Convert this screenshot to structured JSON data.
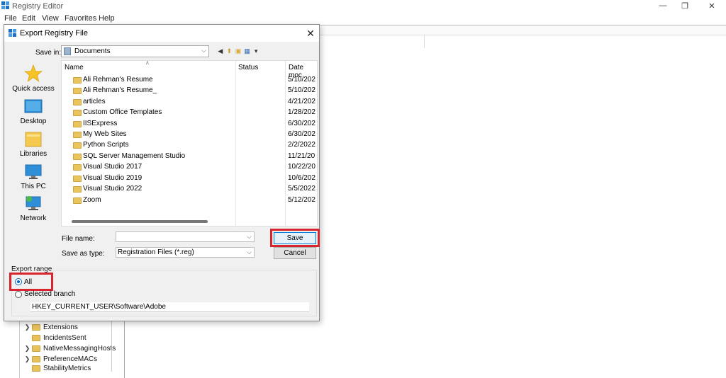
{
  "app": {
    "title": "Registry Editor",
    "menu": [
      "File",
      "Edit",
      "View",
      "Favorites",
      "Help"
    ],
    "window_controls": {
      "minimize": "—",
      "maximize": "❐",
      "close": "✕"
    }
  },
  "tree": {
    "items": [
      {
        "label": "Extensions",
        "expandable": true
      },
      {
        "label": "IncidentsSent",
        "expandable": false
      },
      {
        "label": "NativeMessagingHosts",
        "expandable": true
      },
      {
        "label": "PreferenceMACs",
        "expandable": true
      },
      {
        "label": "StabilityMetrics",
        "expandable": false
      }
    ]
  },
  "dialog": {
    "title": "Export Registry File",
    "close": "✕",
    "save_in_label": "Save in:",
    "save_in_value": "Documents",
    "places": [
      "Quick access",
      "Desktop",
      "Libraries",
      "This PC",
      "Network"
    ],
    "columns": {
      "name": "Name",
      "status": "Status",
      "date": "Date moc"
    },
    "files": [
      {
        "name": "Ali Rehman's Resume",
        "date": "5/10/202"
      },
      {
        "name": "Ali Rehman's Resume_",
        "date": "5/10/202"
      },
      {
        "name": "articles",
        "date": "4/21/202"
      },
      {
        "name": "Custom Office Templates",
        "date": "1/28/202"
      },
      {
        "name": "IISExpress",
        "date": "6/30/202"
      },
      {
        "name": "My Web Sites",
        "date": "6/30/202"
      },
      {
        "name": "Python Scripts",
        "date": "2/2/2022"
      },
      {
        "name": "SQL Server Management Studio",
        "date": "11/21/20"
      },
      {
        "name": "Visual Studio 2017",
        "date": "10/22/20"
      },
      {
        "name": "Visual Studio 2019",
        "date": "10/6/202"
      },
      {
        "name": "Visual Studio 2022",
        "date": "5/5/2022"
      },
      {
        "name": "Zoom",
        "date": "5/12/202"
      }
    ],
    "file_name_label": "File name:",
    "file_name_value": "",
    "save_as_type_label": "Save as type:",
    "save_as_type_value": "Registration Files (*.reg)",
    "save_button": "Save",
    "cancel_button": "Cancel",
    "export_range_label": "Export range",
    "all_label": "All",
    "selected_branch_label": "Selected branch",
    "branch_value": "HKEY_CURRENT_USER\\Software\\Adobe",
    "export_all_selected": true,
    "highlight_color": "#d9262e"
  }
}
